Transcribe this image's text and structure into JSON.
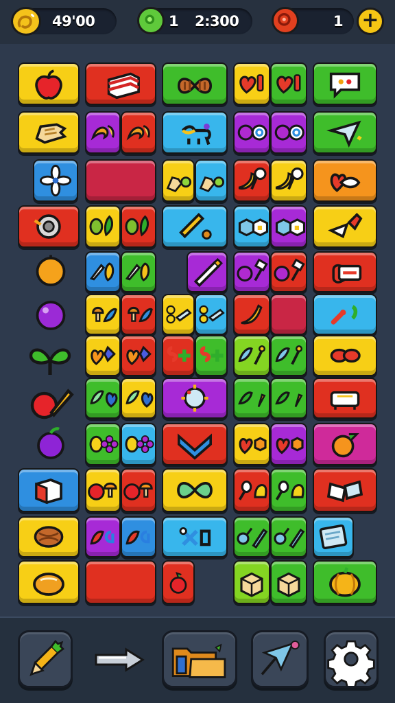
{
  "hud": {
    "coins": "49'00",
    "gems": "1",
    "timer": "2:300",
    "lives": "1",
    "plus_label": "+"
  },
  "colors": {
    "yellow": "#f7cf16",
    "red": "#e03020",
    "green": "#3fbd2b",
    "lime": "#84d522",
    "blue": "#2f8fe0",
    "sky": "#38b6ec",
    "purple": "#a72ad6",
    "magenta": "#cf2a9a",
    "orange": "#f5941d",
    "crimson": "#c92645"
  },
  "board": {
    "columns": 5,
    "rows": 13,
    "tile_icons": [
      "apple",
      "bread",
      "bow",
      "heart-chili",
      "chat-bubble",
      "glove",
      "banana-peel",
      "dog-toy",
      "apple-ring",
      "paper-plane",
      "flower",
      "blank",
      "toast-grape",
      "chili-lollipop",
      "heart-fish",
      "donut-shell",
      "mango-pepper",
      "pencil-dot",
      "box-cube",
      "cone-lollipop",
      "orange",
      "pin-mango",
      "chalk",
      "plum-hammer",
      "candy-bar",
      "grape",
      "mushroom-leaf",
      "cookies-eraser",
      "pepper",
      "sparks",
      "sprout",
      "heart-kite",
      "snake-plus",
      "feather-pin",
      "beans",
      "apple-carrot",
      "leaf-heart",
      "jewel-brooch",
      "leaf-carrot",
      "sofa",
      "plum",
      "lemon-flower",
      "chevron",
      "heart-cube",
      "peach",
      "box",
      "tomato-mushroom",
      "bow-green",
      "spoon-bell",
      "notes",
      "yarn",
      "leaf-letter",
      "tools-letter",
      "cherry-pen",
      "card",
      "bun",
      "block",
      "cherry",
      "crate",
      "pumpkin"
    ]
  },
  "toolbar": {
    "items": [
      "carrot-pencil",
      "arrow-right",
      "folders",
      "kite",
      "settings"
    ]
  }
}
